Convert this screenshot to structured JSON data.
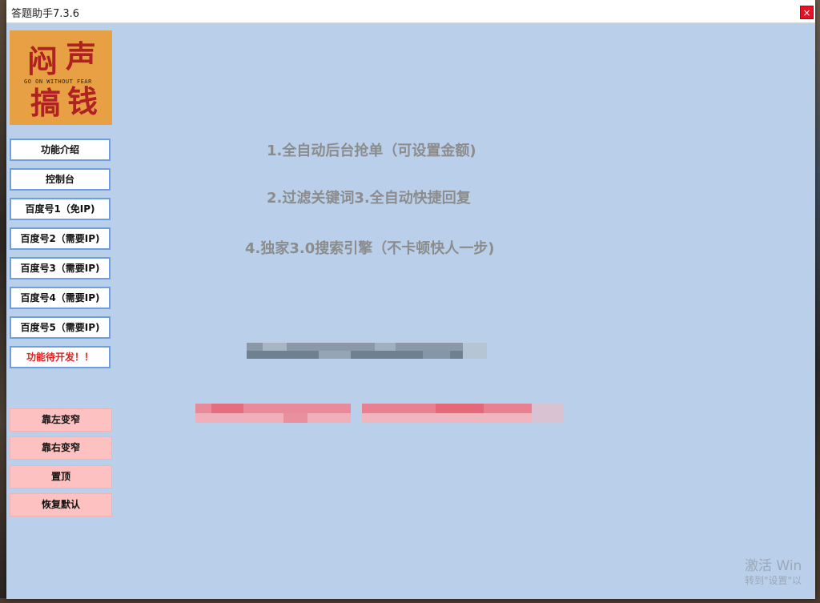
{
  "window": {
    "title": "答题助手7.3.6",
    "close_label": "×"
  },
  "logo": {
    "chars": [
      "闷",
      "声",
      "搞",
      "钱"
    ],
    "subtitle": "GO ON WITHOUT FEAR"
  },
  "nav": [
    {
      "label": "功能介绍"
    },
    {
      "label": "控制台"
    },
    {
      "label": "百度号1（免IP)"
    },
    {
      "label": "百度号2（需要IP)"
    },
    {
      "label": "百度号3（需要IP)"
    },
    {
      "label": "百度号4（需要IP)"
    },
    {
      "label": "百度号5（需要IP)"
    },
    {
      "label": "功能待开发！！"
    }
  ],
  "window_controls": [
    {
      "label": "靠左变窄"
    },
    {
      "label": "靠右变窄"
    },
    {
      "label": "置顶"
    },
    {
      "label": "恢复默认"
    }
  ],
  "features": [
    "1.全自动后台抢单（可设置金额)",
    "2.过滤关键词3.全自动快捷回复",
    "4.独家3.0搜索引擎（不卡顿快人一步)"
  ],
  "desktop_watermark": {
    "line1": "激活 Win",
    "line2": "转到\"设置\"以"
  },
  "colors": {
    "panel_bg": "#bad0ea",
    "nav_border": "#6f9ee0",
    "pink_btn": "#fdc1c1",
    "alert_red": "#e02020",
    "logo_bg": "#e8a044"
  }
}
